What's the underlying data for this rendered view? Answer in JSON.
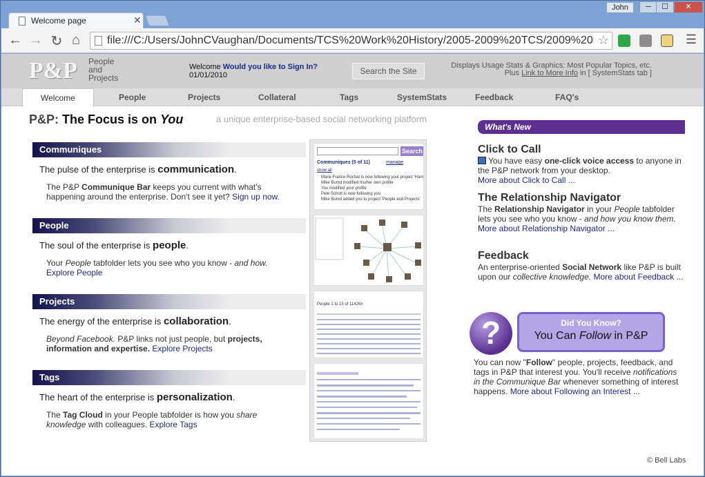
{
  "browser": {
    "tab_title": "Welcome page",
    "user": "John",
    "url": "file:///C:/Users/JohnCVaughan/Documents/TCS%20Work%20History/2005-2009%20TCS/2009%20l",
    "min_glyph": "─",
    "max_glyph": "☐",
    "close_glyph": "✕"
  },
  "header": {
    "logo": "P&P",
    "logo_text": [
      "People",
      "and",
      "Projects"
    ],
    "welcome_label": "Welcome",
    "signin_link": "Would you like to Sign In?",
    "date": "01/01/2010",
    "search_label": "Search the Site",
    "stats_line1": "Displays Usage Stats & Graphics:  Most Popular Topics, etc.",
    "stats_line2_pre": "Plus",
    "stats_link": "Link to More Info",
    "stats_line2_post": "in [ SystemStats tab ]"
  },
  "nav_tabs": [
    "Welcome",
    "People",
    "Projects",
    "Collateral",
    "Tags",
    "SystemStats",
    "Feedback",
    "FAQ's"
  ],
  "headline": {
    "prefix": "P&P:",
    "main": "The Focus is on",
    "em": "You",
    "tagline": "a unique enterprise-based social networking platform"
  },
  "sections": [
    {
      "title": "Communiques",
      "line1_pre": "The pulse of the enterprise is",
      "line1_bold": "communication",
      "line1_post": ".",
      "line2_a": "The P&P",
      "line2_b": "Communique Bar",
      "line2_c": "keeps you current with what's happening around the enterprise. Don't see it yet?",
      "link": "Sign up now",
      "end": "."
    },
    {
      "title": "People",
      "line1_pre": "The soul of the enterprise is",
      "line1_bold": "people",
      "line1_post": ".",
      "line2_a": "Your",
      "line2_b": "People",
      "line2_c": "tabfolder lets you see who you know -",
      "line2_d": "and how.",
      "link": "Explore People"
    },
    {
      "title": "Projects",
      "line1_pre": "The energy of the enterprise is",
      "line1_bold": "collaboration",
      "line1_post": ".",
      "line2_a": "Beyond Facebook.",
      "line2_b": "P&P links not just people, but",
      "line2_c": "projects, information and expertise.",
      "link": "Explore Projects"
    },
    {
      "title": "Tags",
      "line1_pre": "The heart of the enterprise is",
      "line1_bold": "personalization",
      "line1_post": ".",
      "line2_a": "The",
      "line2_b": "Tag Cloud",
      "line2_c": "in your People tabfolder is how you",
      "line2_d": "share knowledge",
      "line2_e": "with colleagues.",
      "link": "Explore Tags"
    }
  ],
  "thumbs": {
    "search_btn": "Search",
    "communiques_title": "Communiques (5 of 11)",
    "manage": "manage",
    "show_all": "show all",
    "items": [
      "Marie France Rochat is now following your project 'Harm",
      "Mike Bumd modified his/her own profile",
      "You modified your profile",
      "Pete Schott is now following you",
      "Mike Bumd added you to project 'People and Projects'"
    ],
    "people_count": "People 1 to 15 of 11426#"
  },
  "whats_new": {
    "title": "What's New",
    "items": [
      {
        "title": "Click to Call",
        "pre": "You have easy",
        "bold": "one-click voice access",
        "post": "to anyone in the P&P network from your desktop.",
        "link": "More about Click to Call ..."
      },
      {
        "title": "The Relationship Navigator",
        "pre": "The",
        "bold": "Relationship Navigator",
        "post": "in your",
        "em": "People",
        "post2": "tabfolder lets you see who you know -",
        "em2": "and how you know them.",
        "link": "More about Relationship Navigator ..."
      },
      {
        "title": "Feedback",
        "pre": "An enterprise-oriented",
        "bold": "Social Network",
        "post": "like P&P is built upon our",
        "em": "collective knowledge.",
        "link": "More about Feedback ..."
      }
    ]
  },
  "did_you_know": {
    "q": "?",
    "title": "Did You Know?",
    "line_pre": "You Can",
    "line_em": "Follow",
    "line_post": "in P&P",
    "text_a": "You can now \"",
    "text_b": "Follow",
    "text_c": "\" people, projects, feedback, and tags in P&P that interest you. You'll receive",
    "text_d": "notifications in the Communique Bar",
    "text_e": "whenever something of interest happens.",
    "link": "More about Following an Interest ..."
  },
  "footer": "© Bell Labs",
  "colors": {
    "accent": "#5d2f91",
    "link": "#1a2a8a",
    "header_bg": "#cfcfcf"
  }
}
